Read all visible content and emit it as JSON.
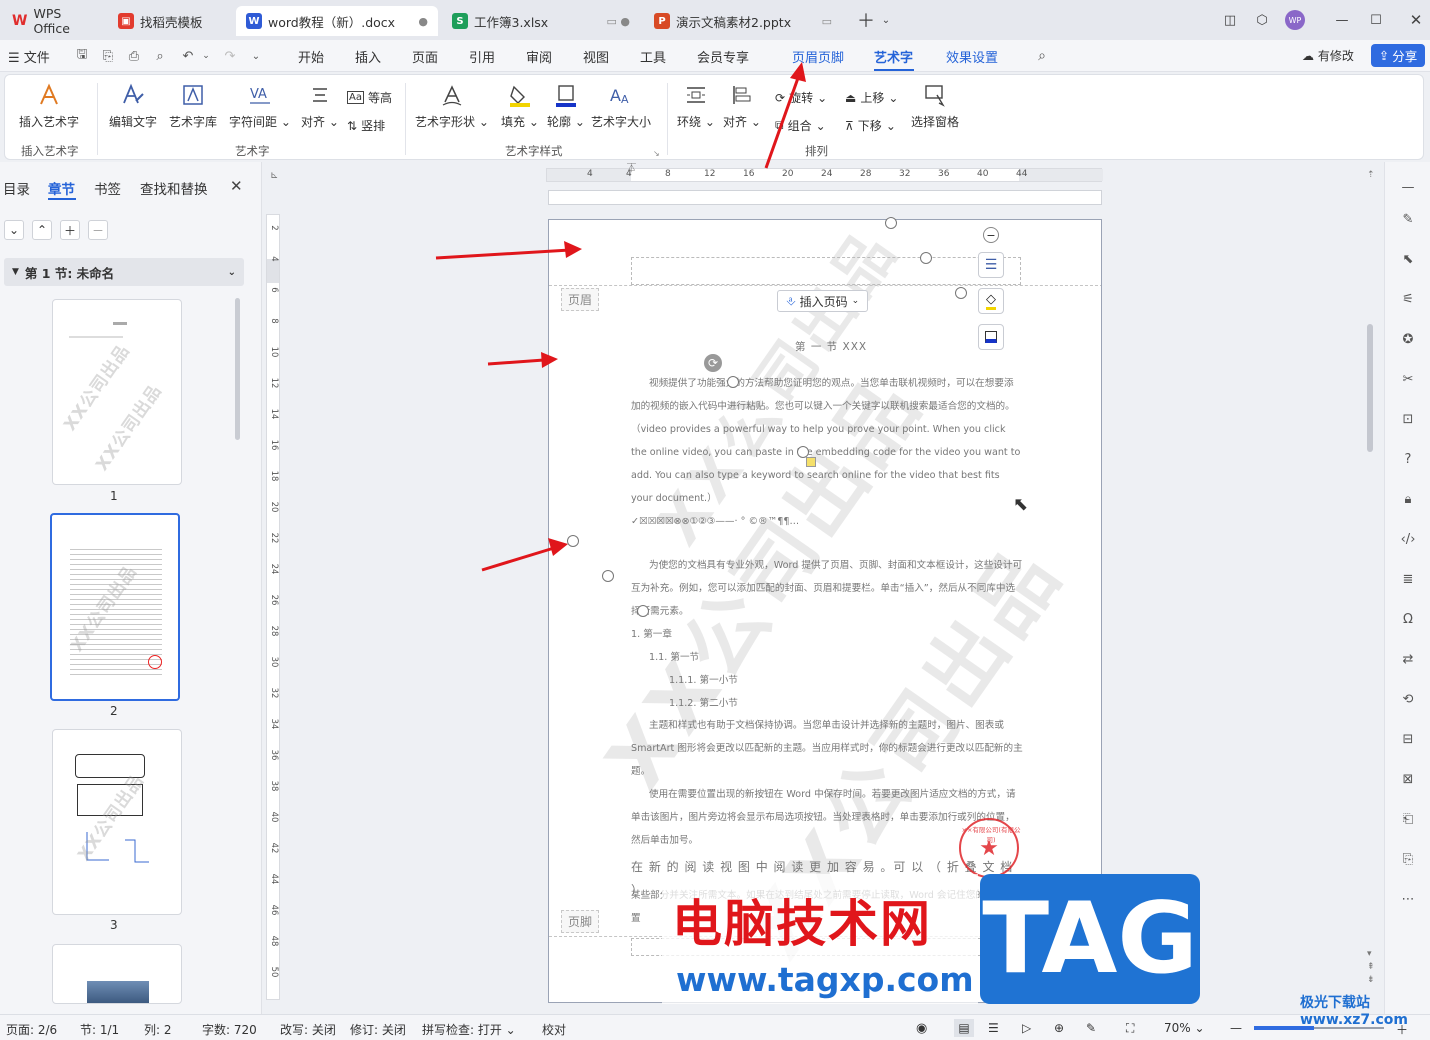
{
  "tabs": [
    {
      "label": "WPS Office",
      "icon": "wps-logo-icon",
      "color": "#e02d2d"
    },
    {
      "label": "找稻壳模板",
      "icon": "docer-icon",
      "color": "#e23b2e"
    },
    {
      "label": "word教程（新）.docx",
      "icon": "word-file-icon",
      "color": "#2f5bd6"
    },
    {
      "label": "工作簿3.xlsx",
      "icon": "excel-file-icon",
      "color": "#1e9e5a"
    },
    {
      "label": "演示文稿素材2.pptx",
      "icon": "ppt-file-icon",
      "color": "#d84a25"
    }
  ],
  "tab_letters": {
    "w": "W",
    "s": "S",
    "p": "P"
  },
  "avatar": "WP",
  "menu": {
    "file": "文件",
    "items": [
      "开始",
      "插入",
      "页面",
      "引用",
      "审阅",
      "视图",
      "工具",
      "会员专享",
      "页眉页脚",
      "艺术字",
      "效果设置"
    ],
    "modified": "有修改",
    "share": "分享"
  },
  "ribbon": {
    "insert_art": "插入艺术字",
    "edit_text": "编辑文字",
    "art_lib": "艺术字库",
    "char_spacing": "字符间距",
    "align": "对齐",
    "equal_height": "等高",
    "vertical": "竖排",
    "art_shape": "艺术字形状",
    "fill": "填充",
    "outline": "轮廓",
    "art_size": "艺术字大小",
    "wrap": "环绕",
    "align2": "对齐",
    "rotate": "旋转",
    "group": "组合",
    "bring_up": "上移",
    "send_down": "下移",
    "selection_pane": "选择窗格",
    "group_labels": {
      "g1": "插入艺术字",
      "g2": "艺术字",
      "g3": "艺术字样式",
      "g4": "排列"
    }
  },
  "left_panel": {
    "tabs": [
      "目录",
      "章节",
      "书签",
      "查找和替换"
    ],
    "section_title": "第 1 节: 未命名",
    "thumb_numbers": [
      "1",
      "2",
      "3"
    ],
    "thumb_watermark": "XX公司出品"
  },
  "ruler_h": [
    "4",
    "4",
    "8",
    "12",
    "16",
    "20",
    "24",
    "28",
    "32",
    "36",
    "40",
    "44"
  ],
  "ruler_v": [
    "2",
    "4",
    "6",
    "8",
    "10",
    "12",
    "14",
    "16",
    "18",
    "20",
    "22",
    "24",
    "26",
    "28",
    "30",
    "32",
    "34",
    "36",
    "38",
    "40",
    "42",
    "44",
    "46",
    "48",
    "50"
  ],
  "doc": {
    "header_label": "页眉",
    "footer_label": "页脚",
    "insert_page_no": "插入页码",
    "watermark": "XX公司出品",
    "heading": "第 一 节   XXX",
    "p1": "视频提供了功能强大的方法帮助您证明您的观点。当您单击联机视频时，可以在想要添加的视频的嵌入代码中进行粘贴。您也可以键入一个关键字以联机搜索最适合您的文档的。（video provides a powerful way to help you prove your point. When you click the online video, you can paste in the embedding code for the video you want to add. You can also type a keyword to search online for the video that best fits your document.）",
    "symbols": "✓☒☒☒☒⊗⊗①②③——·   °  ©®™¶¶…",
    "p2": "为使您的文档具有专业外观，Word 提供了页眉、页脚、封面和文本框设计，这些设计可互为补充。例如，您可以添加匹配的封面、页眉和提要栏。单击“插入”，然后从不同库中选择所需元素。",
    "list": [
      "1.   第一章",
      "1.1.  第一节",
      "1.1.1.   第一小节",
      "1.1.2.   第二小节"
    ],
    "p3": "主题和样式也有助于文档保持协调。当您单击设计并选择新的主题时，图片、图表或 SmartArt 图形将会更改以匹配新的主题。当应用样式时，你的标题会进行更改以匹配新的主题。",
    "p4": "使用在需要位置出现的新按钮在 Word 中保存时间。若要更改图片适应文档的方式，请单击该图片，图片旁边将会显示布局选项按钮。当处理表格时，单击要添加行或列的位置，然后单击加号。",
    "p5": "在 新 的 阅 读 视 图 中 阅 读 更 加 容 易 。可 以 （ 折 叠 文 档 ）",
    "p6": "某些部分并关注所需文本。如果在达到结尾处之前需要停止读取，Word 会记住您的停止位置"
  },
  "stamp_text": "××有限公司(有限公司)",
  "status": {
    "page": "页面: 2/6",
    "section": "节: 1/1",
    "col": "列: 2",
    "words": "字数: 720",
    "overwrite": "改写: 关闭",
    "revise": "修订: 关闭",
    "spell": "拼写检查: 打开",
    "proof": "校对",
    "zoom": "70%"
  },
  "overlay": {
    "brand_cn": "电脑技术网",
    "brand_url": "www.tagxp.com",
    "tag": "TAG",
    "corner": "极光下载站 www.xz7.com"
  },
  "colors": {
    "accent": "#2563d8",
    "arrow": "#e0161b"
  }
}
